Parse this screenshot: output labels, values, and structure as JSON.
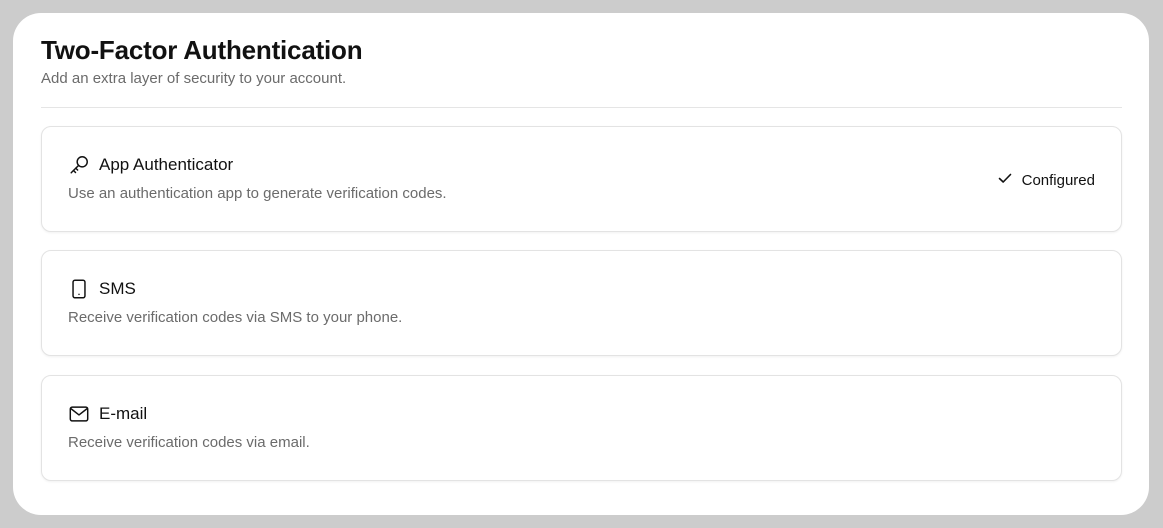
{
  "header": {
    "title": "Two-Factor Authentication",
    "subtitle": "Add an extra layer of security to your account."
  },
  "methods": [
    {
      "icon": "key-icon",
      "title": "App Authenticator",
      "description": "Use an authentication app to generate verification codes.",
      "status": "Configured",
      "status_icon": "check-icon"
    },
    {
      "icon": "phone-icon",
      "title": "SMS",
      "description": "Receive verification codes via SMS to your phone."
    },
    {
      "icon": "mail-icon",
      "title": "E-mail",
      "description": "Receive verification codes via email."
    }
  ],
  "colors": {
    "frame": "#cccccc",
    "panel": "#ffffff",
    "text_primary": "#111111",
    "text_secondary": "#6b6b6b",
    "border": "#e3e3e3"
  }
}
